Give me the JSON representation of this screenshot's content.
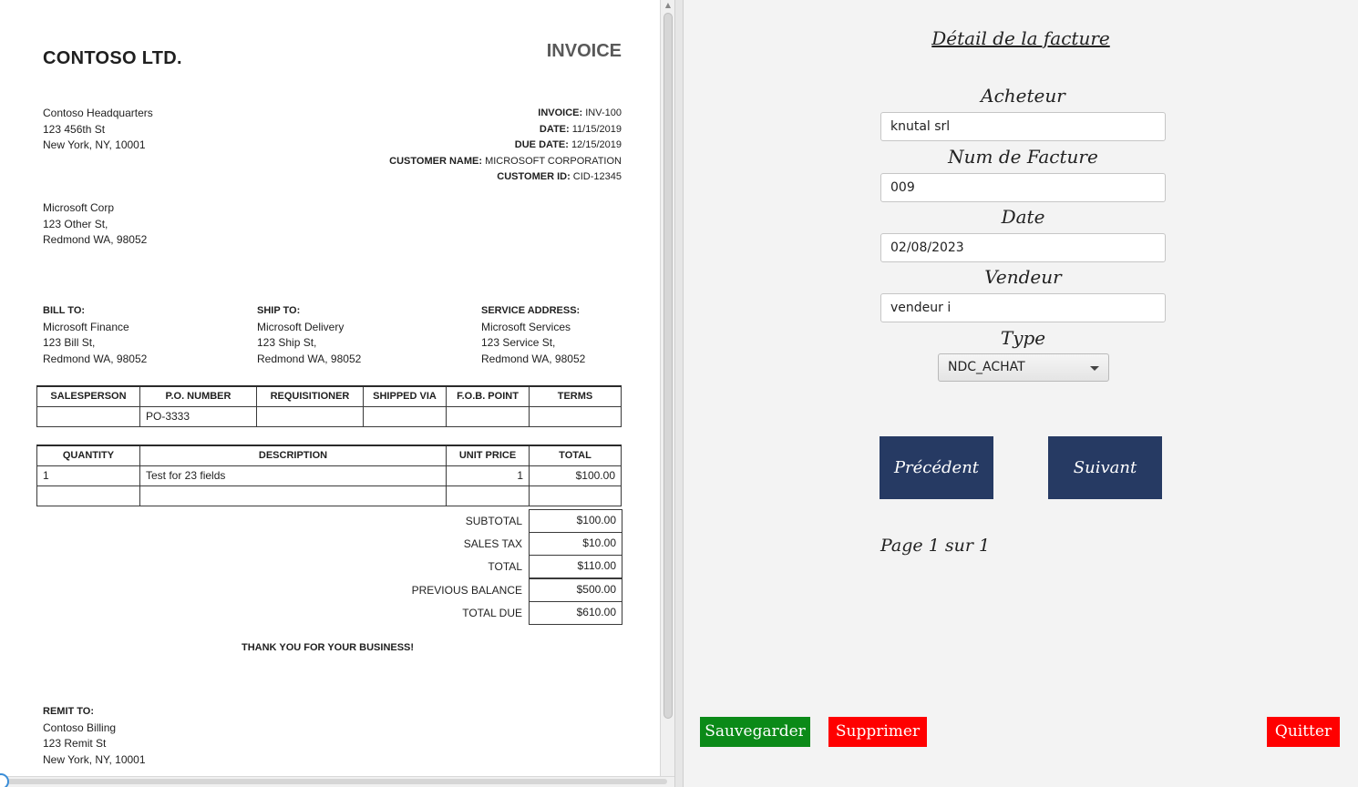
{
  "invoice": {
    "company": "CONTOSO LTD.",
    "title": "INVOICE",
    "company_address": [
      "Contoso Headquarters",
      "123 456th St",
      "New York, NY, 10001"
    ],
    "meta": [
      {
        "label": "INVOICE:",
        "value": "INV-100"
      },
      {
        "label": "DATE:",
        "value": "11/15/2019"
      },
      {
        "label": "DUE DATE:",
        "value": "12/15/2019"
      },
      {
        "label": "CUSTOMER NAME:",
        "value": "MICROSOFT CORPORATION"
      },
      {
        "label": "CUSTOMER ID:",
        "value": "CID-12345"
      }
    ],
    "customer_address": [
      "Microsoft Corp",
      "123 Other St,",
      "Redmond WA, 98052"
    ],
    "bill_to": {
      "label": "BILL TO:",
      "lines": [
        "Microsoft Finance",
        "123 Bill St,",
        "Redmond WA, 98052"
      ]
    },
    "ship_to": {
      "label": "SHIP TO:",
      "lines": [
        "Microsoft Delivery",
        "123 Ship St,",
        "Redmond WA, 98052"
      ]
    },
    "service_address": {
      "label": "SERVICE ADDRESS:",
      "lines": [
        "Microsoft Services",
        "123 Service St,",
        "Redmond WA, 98052"
      ]
    },
    "order_table": {
      "headers": [
        "SALESPERSON",
        "P.O. NUMBER",
        "REQUISITIONER",
        "SHIPPED VIA",
        "F.O.B. POINT",
        "TERMS"
      ],
      "row": [
        "",
        "PO-3333",
        "",
        "",
        "",
        ""
      ]
    },
    "items_table": {
      "headers": [
        "QUANTITY",
        "DESCRIPTION",
        "UNIT PRICE",
        "TOTAL"
      ],
      "rows": [
        [
          "1",
          "Test for 23 fields",
          "1",
          "$100.00"
        ],
        [
          "",
          "",
          "",
          ""
        ]
      ]
    },
    "totals": [
      {
        "label": "SUBTOTAL",
        "value": "$100.00"
      },
      {
        "label": "SALES TAX",
        "value": "$10.00"
      },
      {
        "label": "TOTAL",
        "value": "$110.00"
      },
      {
        "label": "PREVIOUS BALANCE",
        "value": "$500.00"
      },
      {
        "label": "TOTAL DUE",
        "value": "$610.00"
      }
    ],
    "thanks": "THANK YOU FOR YOUR BUSINESS!",
    "remit_to": {
      "label": "REMIT TO:",
      "lines": [
        "Contoso Billing",
        "123 Remit St",
        "New York, NY, 10001"
      ]
    }
  },
  "form": {
    "title": "Détail de la facture",
    "acheteur_label": "Acheteur",
    "acheteur_value": "knutal srl",
    "num_label": "Num de Facture",
    "num_value": "009",
    "date_label": "Date",
    "date_value": "02/08/2023",
    "vendeur_label": "Vendeur",
    "vendeur_value": "vendeur i",
    "type_label": "Type",
    "type_value": "NDC_ACHAT",
    "prev_label": "Précédent",
    "next_label": "Suivant",
    "page_info": "Page 1 sur 1",
    "save_label": "Sauvegarder",
    "delete_label": "Supprimer",
    "quit_label": "Quitter"
  },
  "colors": {
    "nav_button": "#263a63",
    "save_button": "#0b8a18",
    "delete_button": "#ff0000",
    "quit_button": "#ff0000"
  }
}
